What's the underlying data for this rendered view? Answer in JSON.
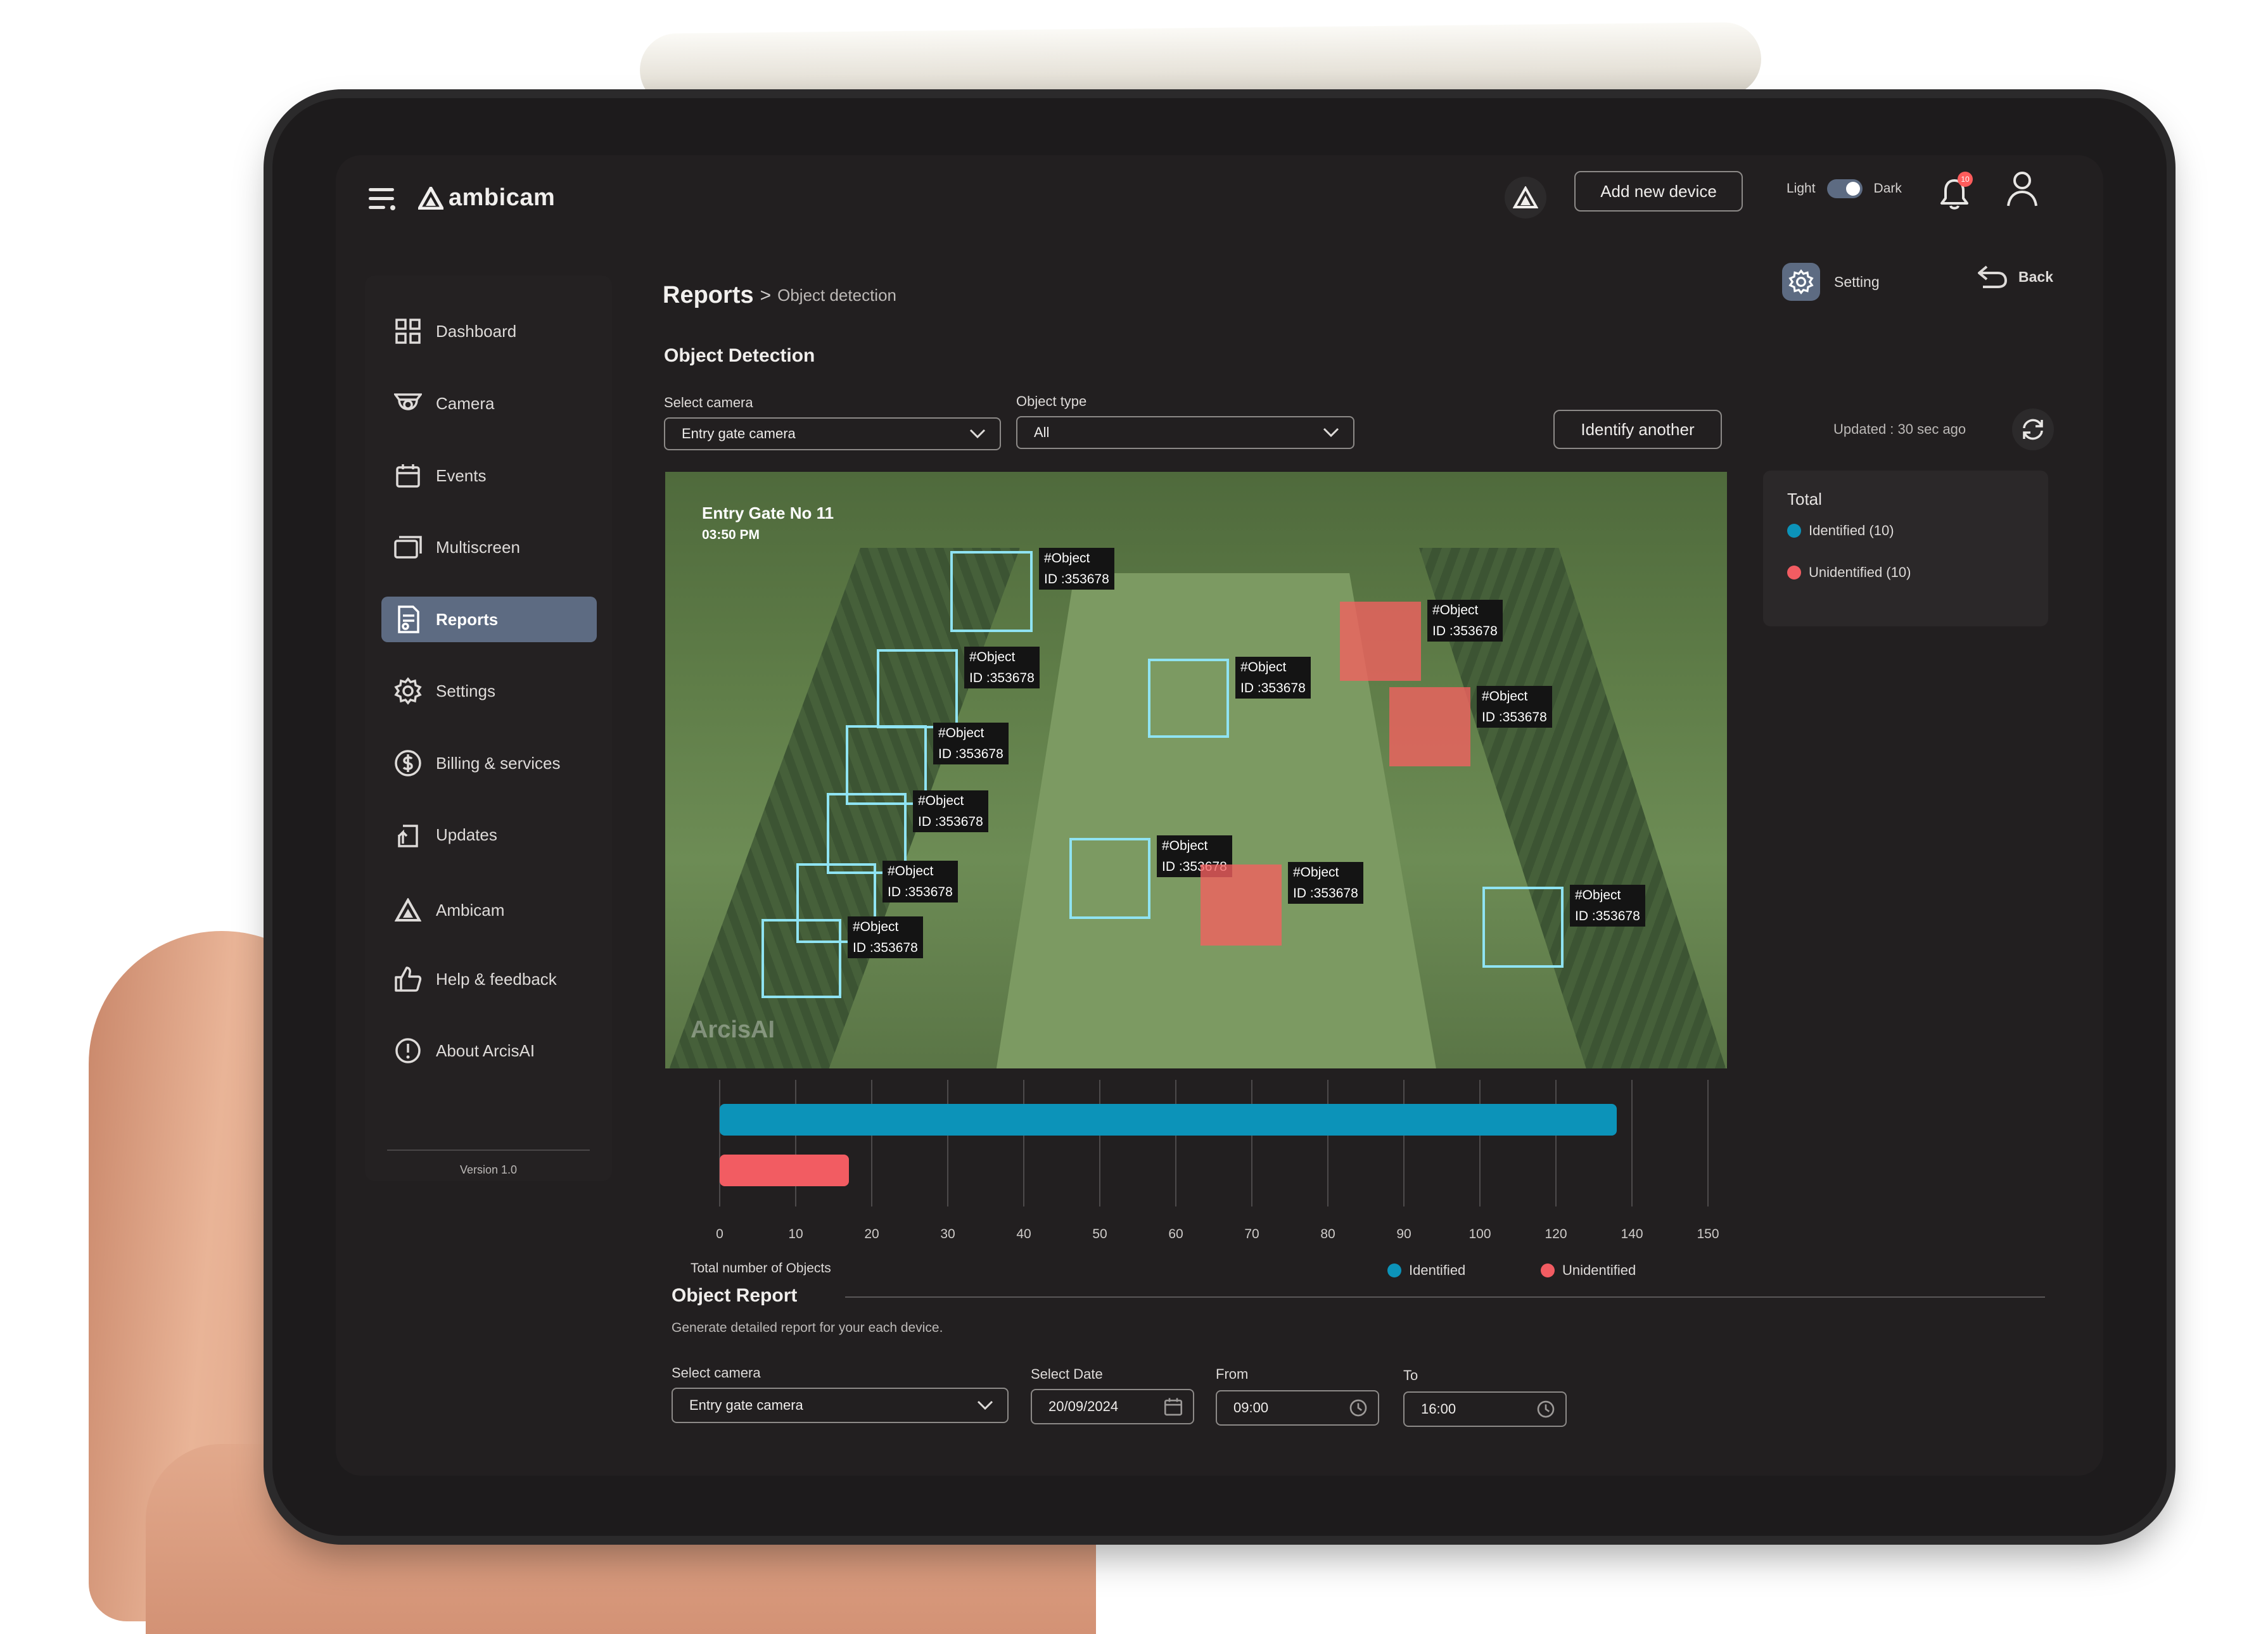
{
  "app": {
    "logo_text": "ambicam"
  },
  "header": {
    "add_device_label": "Add new device",
    "theme_light": "Light",
    "theme_dark": "Dark",
    "theme_is_dark": true,
    "notification_badge": "10"
  },
  "sidebar": {
    "items": [
      {
        "label": "Dashboard",
        "icon": "grid-icon"
      },
      {
        "label": "Camera",
        "icon": "camera-icon"
      },
      {
        "label": "Events",
        "icon": "calendar-icon"
      },
      {
        "label": "Multiscreen",
        "icon": "multiscreen-icon"
      },
      {
        "label": "Reports",
        "icon": "report-icon",
        "active": true
      },
      {
        "label": "Settings",
        "icon": "gear-icon"
      },
      {
        "label": "Billing & services",
        "icon": "dollar-icon"
      },
      {
        "label": "Updates",
        "icon": "update-icon"
      },
      {
        "label": "Ambicam",
        "icon": "ambicam-logo-icon"
      },
      {
        "label": "Help & feedback",
        "icon": "thumbs-up-icon"
      },
      {
        "label": "About ArcisAI",
        "icon": "info-icon"
      }
    ],
    "version": "Version 1.0"
  },
  "breadcrumb": {
    "root": "Reports",
    "separator": ">",
    "current": "Object detection"
  },
  "actions": {
    "setting_label": "Setting",
    "back_label": "Back"
  },
  "detection": {
    "title": "Object Detection",
    "select_camera_label": "Select camera",
    "select_camera_value": "Entry gate camera",
    "object_type_label": "Object type",
    "object_type_value": "All",
    "identify_button": "Identify another",
    "updated_text": "Updated : 30 sec ago"
  },
  "feed": {
    "camera_name": "Entry Gate No 11",
    "time": "03:50 PM",
    "watermark": "ArcisAI",
    "tag_line1": "#Object",
    "tag_line2": "ID :353678"
  },
  "totals": {
    "title": "Total",
    "identified_label": "Identified (10)",
    "unidentified_label": "Unidentified (10)"
  },
  "colors": {
    "identified": "#0c93b9",
    "unidentified": "#f25c62",
    "accent": "#5d6b82",
    "background": "#221f20"
  },
  "chart_data": {
    "type": "bar",
    "orientation": "horizontal",
    "categories": [
      "Identified",
      "Unidentified"
    ],
    "values": [
      136,
      17
    ],
    "ticks": [
      0,
      10,
      20,
      30,
      40,
      50,
      60,
      70,
      80,
      90,
      100,
      120,
      140,
      150
    ],
    "xlabel": "Total number of Objects",
    "legend": [
      "Identified",
      "Unidentified"
    ],
    "legend_position": "bottom-right",
    "grid": true
  },
  "report": {
    "title": "Object  Report",
    "subtitle": "Generate detailed report for your each device.",
    "select_camera_label": "Select camera",
    "select_camera_value": "Entry gate camera",
    "date_label": "Select Date",
    "date_value": "20/09/2024",
    "from_label": "From",
    "from_value": "09:00",
    "to_label": "To",
    "to_value": "16:00"
  }
}
